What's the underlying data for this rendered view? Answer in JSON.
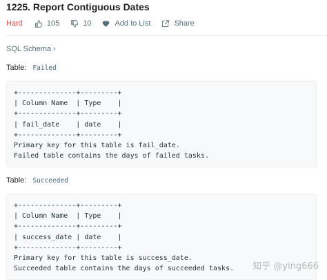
{
  "problem": {
    "title": "1225. Report Contiguous Dates",
    "difficulty": "Hard",
    "likes": "105",
    "dislikes": "10",
    "add_to_list": "Add to List",
    "share": "Share"
  },
  "schema_link": "SQL Schema ›",
  "tables": [
    {
      "label": "Table:",
      "name": "Failed",
      "code": "+--------------+---------+\n| Column Name  | Type    |\n+--------------+---------+\n| fail_date    | date    |\n+--------------+---------+\nPrimary key for this table is fail_date.\nFailed table contains the days of failed tasks."
    },
    {
      "label": "Table:",
      "name": "Succeeded",
      "code": "+--------------+---------+\n| Column Name  | Type    |\n+--------------+---------+\n| success_date | date    |\n+--------------+---------+\nPrimary key for this table is success_date.\nSucceeded table contains the days of succeeded tasks."
    }
  ],
  "watermark": "知乎 @ying666",
  "colors": {
    "difficulty_hard": "#ef4743",
    "muted_text": "#546e7a",
    "code_background": "#f7f9fa"
  },
  "icons": [
    "thumbs-up-icon",
    "thumbs-down-icon",
    "heart-icon",
    "share-icon"
  ]
}
